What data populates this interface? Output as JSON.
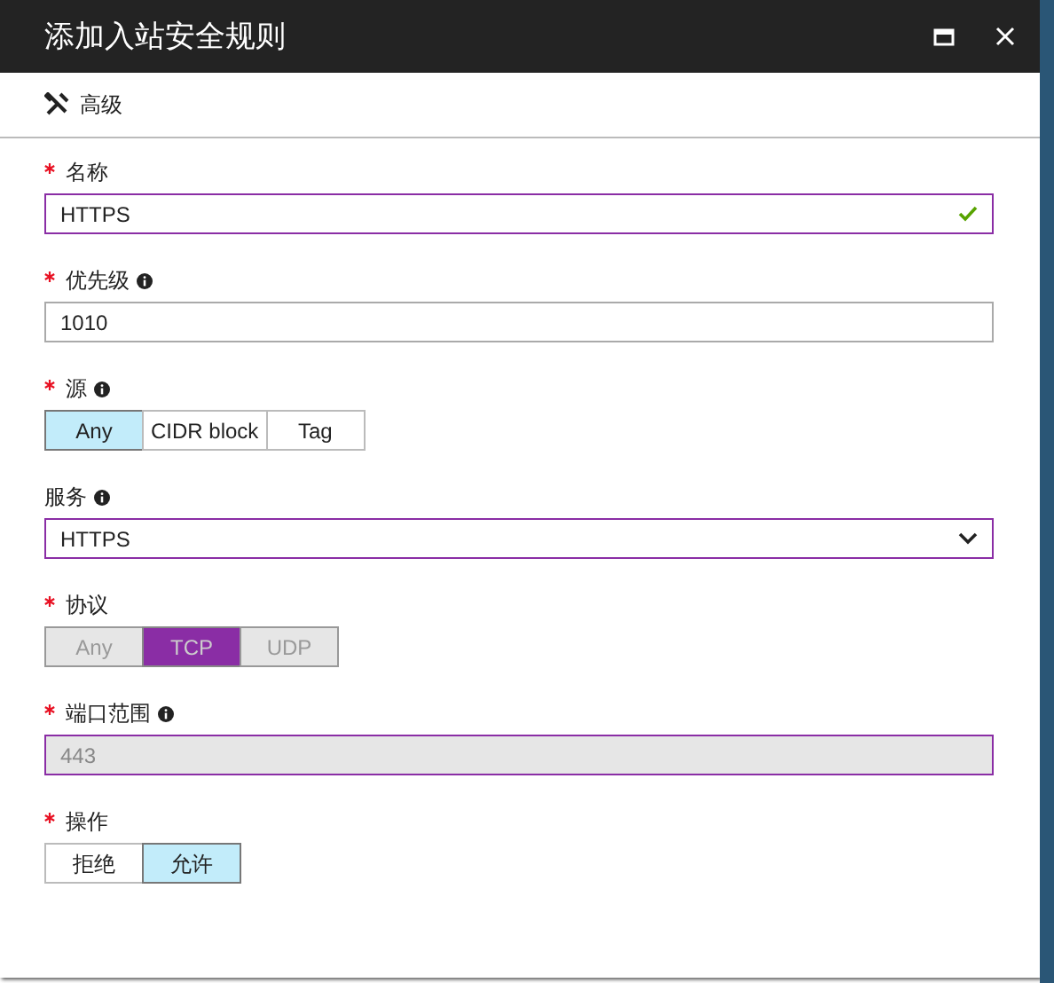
{
  "window": {
    "title": "添加入站安全规则"
  },
  "toolbar": {
    "label": "高级"
  },
  "fields": [
    {
      "kind": "text",
      "label": "名称",
      "required": true,
      "info": false,
      "value": "HTTPS",
      "focused": true,
      "valid": true,
      "disabled": false
    },
    {
      "kind": "text",
      "label": "优先级",
      "required": true,
      "info": true,
      "value": "1010",
      "focused": false,
      "valid": false,
      "disabled": false
    },
    {
      "kind": "segmented",
      "label": "源",
      "required": true,
      "info": true,
      "disabled": false,
      "options": [
        {
          "label": "Any",
          "selected": true
        },
        {
          "label": "CIDR block",
          "selected": false
        },
        {
          "label": "Tag",
          "selected": false
        }
      ]
    },
    {
      "kind": "select",
      "label": "服务",
      "required": false,
      "info": true,
      "value": "HTTPS",
      "focused": true
    },
    {
      "kind": "segmented",
      "label": "协议",
      "required": true,
      "info": false,
      "disabled": true,
      "options": [
        {
          "label": "Any",
          "selected": false
        },
        {
          "label": "TCP",
          "selected": true
        },
        {
          "label": "UDP",
          "selected": false
        }
      ]
    },
    {
      "kind": "text",
      "label": "端口范围",
      "required": true,
      "info": true,
      "value": "443",
      "focused": true,
      "valid": false,
      "disabled": true
    },
    {
      "kind": "segmented",
      "label": "操作",
      "required": true,
      "info": false,
      "disabled": false,
      "options": [
        {
          "label": "拒绝",
          "selected": false
        },
        {
          "label": "允许",
          "selected": true
        }
      ]
    }
  ]
}
